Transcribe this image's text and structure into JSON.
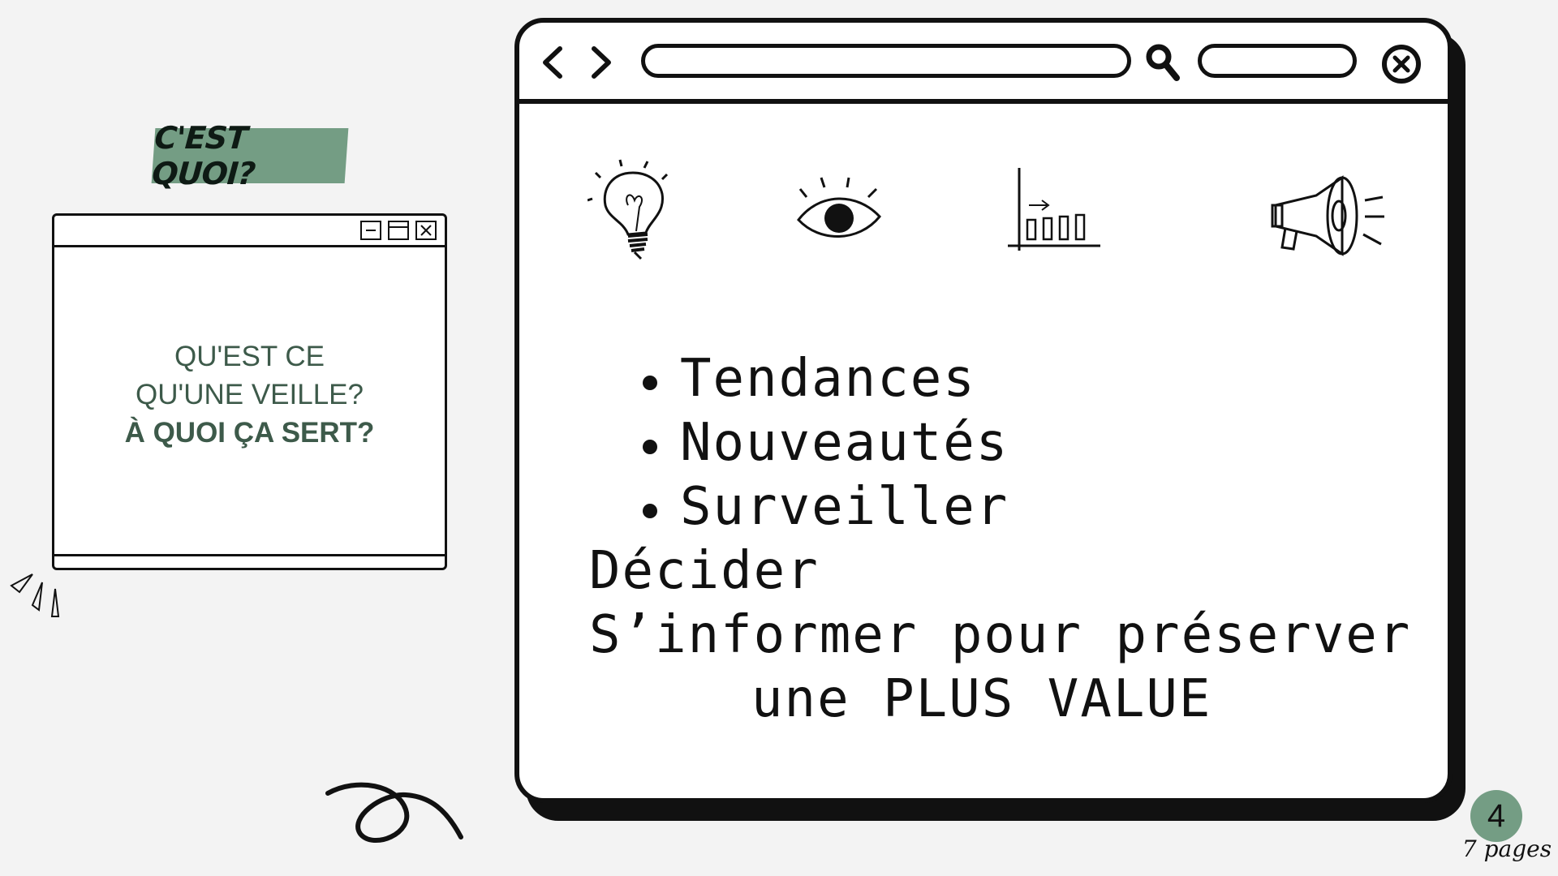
{
  "tag": {
    "label": "C'EST QUOI?"
  },
  "small_window": {
    "question_line1": "QU'EST CE",
    "question_line2": "QU'UNE VEILLE?",
    "question_line3": "À QUOI ÇA SERT?",
    "controls": [
      "minimize-icon",
      "maximize-icon",
      "close-icon"
    ]
  },
  "browser": {
    "nav": [
      "back-arrow-icon",
      "forward-arrow-icon"
    ],
    "url_value": "",
    "search_icon": "search-icon",
    "close_icon": "close-circle-icon",
    "icons": [
      "lightbulb-icon",
      "eye-icon",
      "bar-chart-icon",
      "megaphone-icon"
    ],
    "bullets": [
      "Tendances",
      "Nouveautés",
      "Surveiller"
    ],
    "line_decider": "Décider",
    "line_informer": "S’informer pour préserver",
    "line_value": "une PLUS VALUE"
  },
  "page": {
    "number": "4",
    "total_label": "7 pages"
  },
  "colors": {
    "accent": "#749d84",
    "text_green": "#3d5a4a",
    "ink": "#111111",
    "background": "#f3f3f3"
  }
}
